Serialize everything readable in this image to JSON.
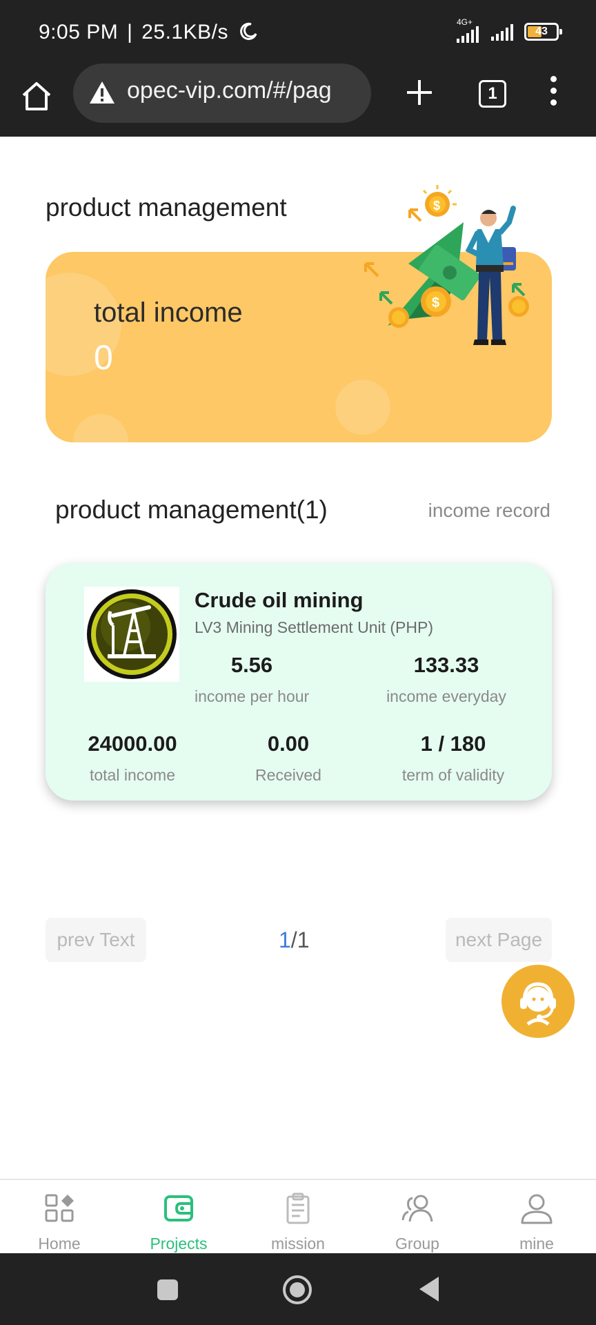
{
  "status_bar": {
    "time": "9:05 PM",
    "speed": "25.1KB/s",
    "network": "4G+",
    "battery": "43",
    "moon_icon": "moon-icon"
  },
  "browser": {
    "url": "opec-vip.com/#/pag",
    "tab_count": "1",
    "icons": [
      "home-icon",
      "warning-icon",
      "plus-icon",
      "tabs-icon",
      "more-icon"
    ]
  },
  "page": {
    "title": "product management",
    "income_card": {
      "label": "total income",
      "value": "0"
    },
    "section": {
      "title": "product management(1)",
      "record_link": "income record"
    },
    "product": {
      "name": "Crude oil mining",
      "unit": "LV3 Mining Settlement Unit (PHP)",
      "stats": {
        "per_hour_value": "5.56",
        "per_hour_label": "income per hour",
        "everyday_value": "133.33",
        "everyday_label": "income everyday",
        "total_value": "24000.00",
        "total_label": "total income",
        "received_value": "0.00",
        "received_label": "Received",
        "term_value": "1 / 180",
        "term_label": "term of validity"
      }
    },
    "pagination": {
      "prev": "prev Text",
      "current": "1",
      "separator": "/",
      "total": "1",
      "next": "next Page"
    }
  },
  "bottom_nav": {
    "items": [
      {
        "label": "Home",
        "icon": "grid-icon"
      },
      {
        "label": "Projects",
        "icon": "wallet-icon"
      },
      {
        "label": "mission",
        "icon": "clipboard-icon"
      },
      {
        "label": "Group",
        "icon": "group-icon"
      },
      {
        "label": "mine",
        "icon": "user-icon"
      }
    ],
    "active": "Projects"
  },
  "colors": {
    "accent_green": "#2cbf7c",
    "card_yellow": "#fdc865",
    "product_card_bg": "#e5fcf1",
    "pager_blue": "#3d7be0",
    "support_orange": "#f0b133"
  }
}
